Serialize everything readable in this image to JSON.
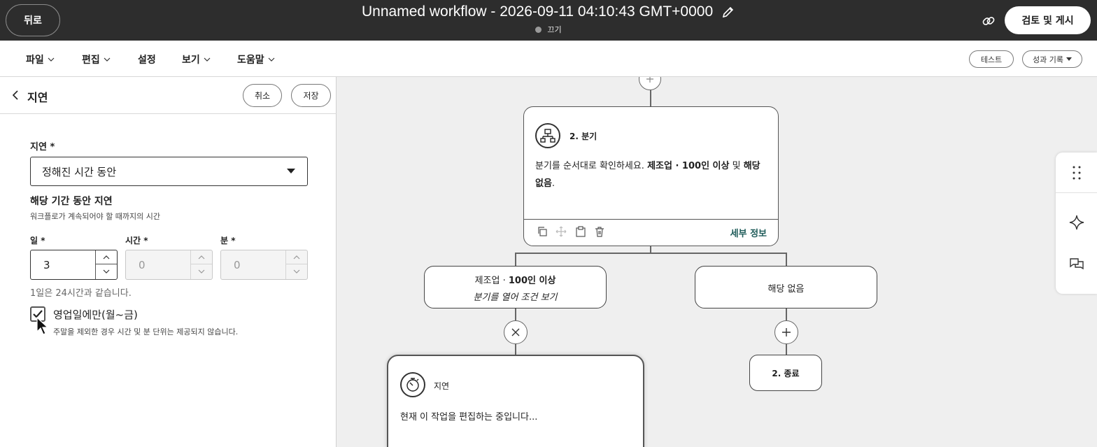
{
  "topbar": {
    "back_label": "뒤로",
    "title": "Unnamed workflow - 2026-09-11 04:10:43 GMT+0000",
    "status": "끄기",
    "publish_label": "검토 및 게시"
  },
  "menu": {
    "items": [
      {
        "label": "파일",
        "has_dropdown": true
      },
      {
        "label": "편집",
        "has_dropdown": true
      },
      {
        "label": "설정",
        "has_dropdown": false
      },
      {
        "label": "보기",
        "has_dropdown": true
      },
      {
        "label": "도움말",
        "has_dropdown": true
      }
    ],
    "test_label": "테스트",
    "performance_label": "성과 기록"
  },
  "panel": {
    "title": "지연",
    "cancel_label": "취소",
    "save_label": "저장",
    "delay_label": "지연 *",
    "delay_selected": "정해진 시간 동안",
    "duration_title": "해당 기간 동안 지연",
    "duration_sub": "워크플로가 계속되어야 할 때까지의 시간",
    "days_label": "일 *",
    "days_value": "3",
    "hours_label": "시간 *",
    "hours_value": "0",
    "minutes_label": "분 *",
    "minutes_value": "0",
    "day_note": "1일은 24시간과 같습니다.",
    "business_days_label": "영업일에만(월~금)",
    "business_days_checked": true,
    "business_days_note": "주말을 제외한 경우 시간 및 분 단위는 제공되지 않습니다."
  },
  "canvas": {
    "branch_card": {
      "title": "2. 분기",
      "body_prefix": "분기를 순서대로 확인하세요. ",
      "body_bold1": "제조업 · 100인 이상",
      "body_mid": " 및 ",
      "body_bold2": "해당 없음",
      "body_suffix": ".",
      "details_label": "세부 정보"
    },
    "branch_a": {
      "title_prefix": "제조업 · ",
      "title_bold": "100인 이상",
      "subtitle": "분기를 열어 조건 보기"
    },
    "branch_b": {
      "title": "해당 없음"
    },
    "end_node": {
      "label": "2. 종료"
    },
    "delay_card": {
      "title": "지연",
      "body": "현재 이 작업을 편집하는 중입니다..."
    }
  },
  "colors": {
    "topbar": "#2d2d2d",
    "details_link": "#1f5c5a",
    "canvas_bg": "#efefef"
  }
}
